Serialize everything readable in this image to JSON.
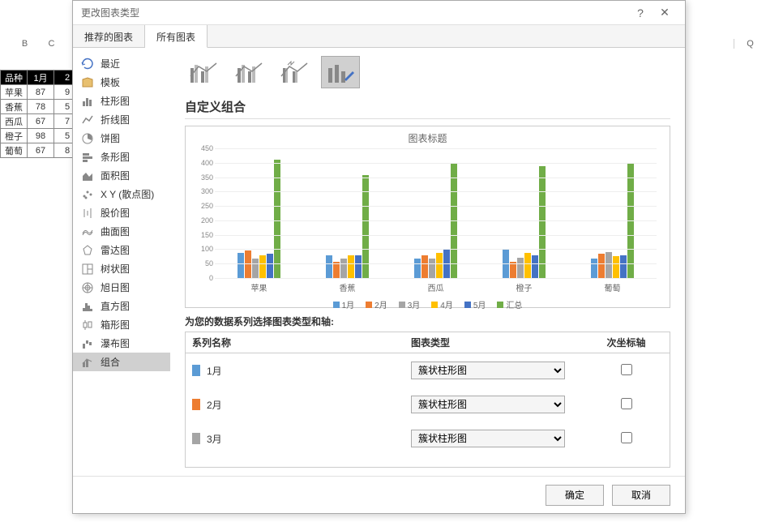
{
  "dialog": {
    "title": "更改图表类型",
    "help": "?",
    "close": "✕",
    "tabs": {
      "recommended": "推荐的图表",
      "all": "所有图表"
    }
  },
  "chart_types": [
    {
      "label": "最近",
      "icon": "recent"
    },
    {
      "label": "模板",
      "icon": "template"
    },
    {
      "label": "柱形图",
      "icon": "column"
    },
    {
      "label": "折线图",
      "icon": "line"
    },
    {
      "label": "饼图",
      "icon": "pie"
    },
    {
      "label": "条形图",
      "icon": "bar"
    },
    {
      "label": "面积图",
      "icon": "area"
    },
    {
      "label": "X Y (散点图)",
      "icon": "scatter"
    },
    {
      "label": "股价图",
      "icon": "stock"
    },
    {
      "label": "曲面图",
      "icon": "surface"
    },
    {
      "label": "雷达图",
      "icon": "radar"
    },
    {
      "label": "树状图",
      "icon": "tree"
    },
    {
      "label": "旭日图",
      "icon": "sunburst"
    },
    {
      "label": "直方图",
      "icon": "histo"
    },
    {
      "label": "箱形图",
      "icon": "box"
    },
    {
      "label": "瀑布图",
      "icon": "waterfall"
    },
    {
      "label": "组合",
      "icon": "combo"
    }
  ],
  "section_title": "自定义组合",
  "chart_data": {
    "type": "bar",
    "title": "图表标题",
    "categories": [
      "苹果",
      "香蕉",
      "西瓜",
      "橙子",
      "葡萄"
    ],
    "series": [
      {
        "name": "1月",
        "color": "#5b9bd5",
        "values": [
          87,
          78,
          67,
          98,
          67
        ]
      },
      {
        "name": "2月",
        "color": "#ed7d31",
        "values": [
          95,
          55,
          78,
          55,
          85
        ]
      },
      {
        "name": "3月",
        "color": "#a5a5a5",
        "values": [
          67,
          67,
          67,
          70,
          90
        ]
      },
      {
        "name": "4月",
        "color": "#ffc000",
        "values": [
          78,
          78,
          88,
          88,
          75
        ]
      },
      {
        "name": "5月",
        "color": "#4472c4",
        "values": [
          85,
          78,
          100,
          78,
          80
        ]
      },
      {
        "name": "汇总",
        "color": "#70ad47",
        "values": [
          412,
          356,
          400,
          389,
          397
        ]
      }
    ],
    "ylim": [
      0,
      450
    ],
    "yticks": [
      0,
      50,
      100,
      150,
      200,
      250,
      300,
      350,
      400,
      450
    ]
  },
  "series_label": "为您的数据系列选择图表类型和轴:",
  "series_headers": {
    "name": "系列名称",
    "type": "图表类型",
    "axis": "次坐标轴"
  },
  "series_rows": [
    {
      "name": "1月",
      "color": "#5b9bd5",
      "type": "簇状柱形图",
      "secondary": false
    },
    {
      "name": "2月",
      "color": "#ed7d31",
      "type": "簇状柱形图",
      "secondary": false
    },
    {
      "name": "3月",
      "color": "#a5a5a5",
      "type": "簇状柱形图",
      "secondary": false
    }
  ],
  "footer": {
    "ok": "确定",
    "cancel": "取消"
  },
  "sheet": {
    "cols_left": [
      "B",
      "C"
    ],
    "cols_right": [
      "Q"
    ],
    "headers": [
      "品种",
      "1月",
      "2"
    ],
    "rows": [
      [
        "苹果",
        "87",
        "9"
      ],
      [
        "香蕉",
        "78",
        "5"
      ],
      [
        "西瓜",
        "67",
        "7"
      ],
      [
        "橙子",
        "98",
        "5"
      ],
      [
        "葡萄",
        "67",
        "8"
      ]
    ]
  }
}
